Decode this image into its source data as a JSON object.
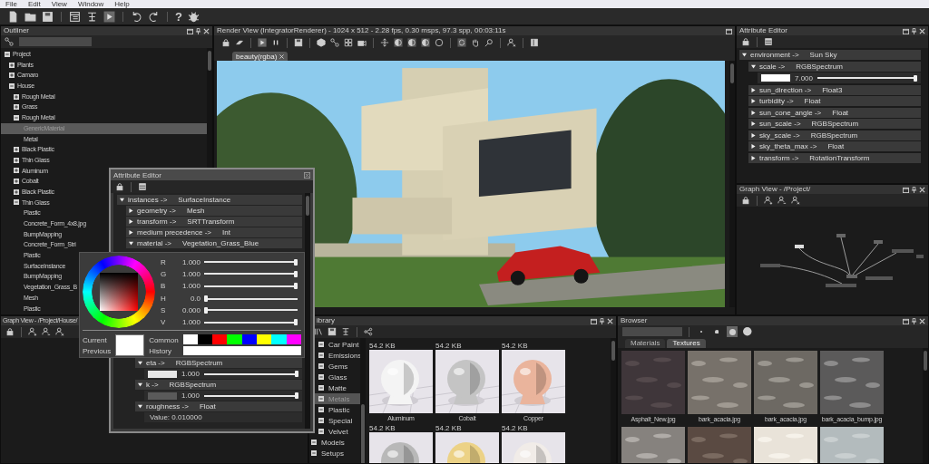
{
  "menu": [
    "File",
    "Edit",
    "View",
    "Window",
    "Help"
  ],
  "toolbar": {
    "help": "?"
  },
  "outliner": {
    "title": "Outliner",
    "tree": [
      {
        "label": "Project",
        "expanded": true,
        "selected": false,
        "children": [
          {
            "label": "Plants",
            "expanded": false,
            "selected": false
          },
          {
            "label": "Camaro",
            "expanded": false,
            "selected": false
          },
          {
            "label": "House",
            "expanded": true,
            "selected": false,
            "children": [
              {
                "label": "Rough Metal",
                "expanded": false,
                "selected": false
              },
              {
                "label": "Grass",
                "expanded": false,
                "selected": false
              },
              {
                "label": "Rough Metal",
                "expanded": true,
                "selected": false,
                "children": [
                  {
                    "label": "GenericMaterial",
                    "selected": true
                  },
                  {
                    "label": "Metal",
                    "selected": false
                  }
                ]
              },
              {
                "label": "Black Plastic",
                "expanded": false,
                "selected": false
              },
              {
                "label": "Thin Glass",
                "expanded": false,
                "selected": false
              },
              {
                "label": "Aluminum",
                "expanded": false,
                "selected": false
              },
              {
                "label": "Cobalt",
                "expanded": false,
                "selected": false
              },
              {
                "label": "Black Plastic",
                "expanded": false,
                "selected": false
              },
              {
                "label": "Thin Glass",
                "expanded": true,
                "selected": false,
                "children": [
                  {
                    "label": "Plastic",
                    "selected": false
                  },
                  {
                    "label": "Concrete_Form_4x8.jpg",
                    "selected": false
                  },
                  {
                    "label": "BumpMapping",
                    "selected": false
                  },
                  {
                    "label": "Concrete_Form_Stri",
                    "selected": false
                  },
                  {
                    "label": "Plastic",
                    "selected": false
                  },
                  {
                    "label": "SurfaceInstance",
                    "selected": false
                  },
                  {
                    "label": "BumpMapping",
                    "selected": false
                  },
                  {
                    "label": "Vegetation_Grass_B",
                    "selected": false
                  },
                  {
                    "label": "Mesh",
                    "selected": false
                  },
                  {
                    "label": "Plastic",
                    "selected": false
                  }
                ]
              }
            ]
          }
        ]
      }
    ]
  },
  "render": {
    "title": "Render View (IntegratorRenderer) - 1024 x 512 -  2.28 fps,  0.30 msps,  97.3 spp, 00:03:11s",
    "tabs": [
      {
        "label": "beauty(rgba)",
        "selected": true
      }
    ]
  },
  "attributes": {
    "title": "Attribute Editor",
    "rows": [
      {
        "kind": "group",
        "label": "environment ->",
        "type": "Sun Sky",
        "expanded": true,
        "children": [
          {
            "kind": "group",
            "label": "scale ->",
            "type": "RGBSpectrum",
            "expanded": true,
            "children": [
              {
                "kind": "slider",
                "value": "7.000",
                "level": 1,
                "color": "#ffffff"
              }
            ]
          },
          {
            "kind": "group",
            "label": "sun_direction ->",
            "type": "Float3",
            "expanded": false
          },
          {
            "kind": "group",
            "label": "turbidity ->",
            "type": "Float",
            "expanded": false
          },
          {
            "kind": "group",
            "label": "sun_cone_angle ->",
            "type": "Float",
            "expanded": false
          },
          {
            "kind": "group",
            "label": "sun_scale ->",
            "type": "RGBSpectrum",
            "expanded": false
          },
          {
            "kind": "group",
            "label": "sky_scale ->",
            "type": "RGBSpectrum",
            "expanded": false
          },
          {
            "kind": "group",
            "label": "sky_theta_max ->",
            "type": "Float",
            "expanded": false
          },
          {
            "kind": "group",
            "label": "transform ->",
            "type": "RotationTransform",
            "expanded": false
          }
        ]
      }
    ]
  },
  "graph_right": {
    "title": "Graph View - /Project/"
  },
  "graph_left": {
    "title": "Graph View - /Project/House/"
  },
  "floating_editor": {
    "title": "Attribute Editor",
    "rows": [
      {
        "kind": "group",
        "label": "instances ->",
        "type": "SurfaceInstance",
        "expanded": true,
        "children": [
          {
            "kind": "group",
            "label": "geometry ->",
            "type": "Mesh",
            "expanded": false
          },
          {
            "kind": "group",
            "label": "transform ->",
            "type": "SRTTransform",
            "expanded": false
          },
          {
            "kind": "group",
            "label": "medium precedence ->",
            "type": "Int",
            "expanded": false
          },
          {
            "kind": "group",
            "label": "material ->",
            "type": "Vegetation_Grass_Blue",
            "expanded": true,
            "children": [
              {
                "kind": "group",
                "label": "eta ->",
                "type": "RGBSpectrum",
                "expanded": true,
                "children": [
                  {
                    "kind": "slider",
                    "value": "1.000",
                    "level": 1,
                    "color": "#e6e6e6"
                  }
                ]
              },
              {
                "kind": "group",
                "label": "k ->",
                "type": "RGBSpectrum",
                "expanded": true,
                "children": [
                  {
                    "kind": "slider",
                    "value": "1.000",
                    "level": 1,
                    "color": "#5a5a5a"
                  }
                ]
              },
              {
                "kind": "group",
                "label": "roughness ->",
                "type": "Float",
                "expanded": true,
                "children": [
                  {
                    "kind": "value",
                    "text": "Value:  0.010000"
                  }
                ]
              }
            ]
          }
        ]
      }
    ]
  },
  "color_picker": {
    "channels": [
      {
        "name": "R",
        "value": "1.000",
        "level": 1
      },
      {
        "name": "G",
        "value": "1.000",
        "level": 1
      },
      {
        "name": "B",
        "value": "1.000",
        "level": 1
      },
      {
        "name": "H",
        "value": "0.0",
        "level": 0
      },
      {
        "name": "S",
        "value": "0.000",
        "level": 0
      },
      {
        "name": "V",
        "value": "1.000",
        "level": 1
      }
    ],
    "current": {
      "label": "Current",
      "color": "#ffffff"
    },
    "previous": {
      "label": "Previous",
      "color": "#ffffff"
    },
    "common_label": "Common",
    "common": [
      {
        "color": "#ffffff"
      },
      {
        "color": "#000000"
      },
      {
        "color": "#ff0000"
      },
      {
        "color": "#00ff00"
      },
      {
        "color": "#0000ff"
      },
      {
        "color": "#ffff00"
      },
      {
        "color": "#00ffff"
      },
      {
        "color": "#ff00ff"
      }
    ],
    "history_label": "History"
  },
  "library": {
    "title": "ibrary",
    "categories": [
      {
        "label": "Car Paint",
        "selected": false
      },
      {
        "label": "Emissions",
        "selected": false
      },
      {
        "label": "Gems",
        "selected": false
      },
      {
        "label": "Glass",
        "selected": false
      },
      {
        "label": "Matte",
        "selected": false
      },
      {
        "label": "Metals",
        "selected": true
      },
      {
        "label": "Plastic",
        "selected": false
      },
      {
        "label": "Special",
        "selected": false
      },
      {
        "label": "Velvet",
        "selected": false
      }
    ],
    "sections": [
      {
        "label": "Models",
        "selected": false
      },
      {
        "label": "Setups",
        "selected": false
      }
    ],
    "items": [
      {
        "size": "54.2 KB",
        "name": "Aluminum"
      },
      {
        "size": "54.2 KB",
        "name": "Cobalt"
      },
      {
        "size": "54.2 KB",
        "name": "Copper"
      },
      {
        "size": "54.2 KB"
      },
      {
        "size": "54.2 KB"
      },
      {
        "size": "54.2 KB"
      }
    ]
  },
  "browser": {
    "title": "Browser",
    "sizes": [
      {
        "selected": false
      },
      {
        "selected": false
      },
      {
        "selected": true
      },
      {
        "selected": false
      }
    ],
    "tabs": [
      {
        "label": "Materials",
        "selected": false
      },
      {
        "label": "Textures",
        "selected": true
      }
    ],
    "items": [
      {
        "kind": "picture",
        "name": "Asphalt_New.jpg"
      },
      {
        "kind": "picture",
        "name": "bark_acacia.jpg"
      },
      {
        "kind": "picture",
        "name": "bark_acacia.jpg"
      },
      {
        "kind": "picture",
        "name": "bark_acacia_bump.jpg"
      },
      {
        "kind": "picture"
      },
      {
        "kind": "picture"
      },
      {
        "kind": "picture"
      },
      {
        "kind": "picture"
      }
    ]
  }
}
